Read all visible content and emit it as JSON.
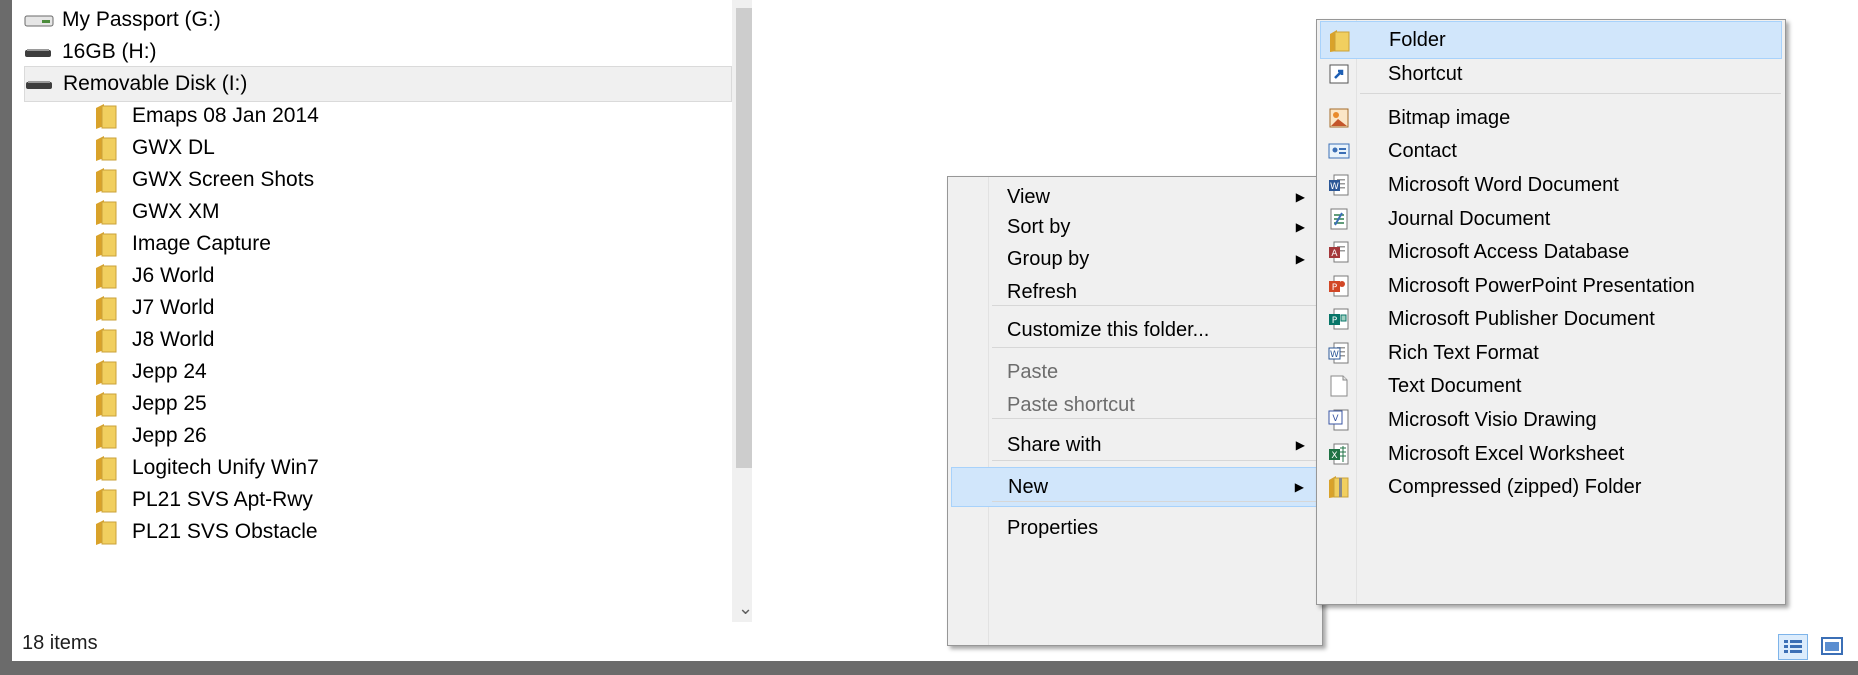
{
  "nav": {
    "drives": [
      {
        "label": "My Passport (G:)",
        "icon": "external-drive-icon"
      },
      {
        "label": "16GB (H:)",
        "icon": "usb-drive-icon"
      },
      {
        "label": "Removable Disk (I:)",
        "icon": "usb-drive-icon"
      }
    ],
    "folders": [
      "Emaps 08 Jan 2014",
      "GWX DL",
      "GWX Screen Shots",
      "GWX XM",
      "Image Capture",
      "J6 World",
      "J7 World",
      "J8 World",
      "Jepp 24",
      "Jepp 25",
      "Jepp 26",
      "Logitech Unify Win7",
      "PL21 SVS Apt-Rwy",
      "PL21 SVS Obstacle"
    ]
  },
  "status": {
    "item_count": "18 items"
  },
  "context_menu": {
    "items": [
      {
        "label": "View",
        "submenu": true
      },
      {
        "label": "Sort by",
        "submenu": true
      },
      {
        "label": "Group by",
        "submenu": true
      },
      {
        "label": "Refresh",
        "submenu": false
      },
      {
        "label": "Customize this folder...",
        "submenu": false
      },
      {
        "label": "Paste",
        "submenu": false,
        "disabled": true
      },
      {
        "label": "Paste shortcut",
        "submenu": false,
        "disabled": true
      },
      {
        "label": "Share with",
        "submenu": true
      },
      {
        "label": "New",
        "submenu": true,
        "highlighted": true
      },
      {
        "label": "Properties",
        "submenu": false
      }
    ],
    "arrow_glyph": "▶"
  },
  "new_submenu": {
    "items": [
      {
        "label": "Folder",
        "icon": "folder-icon",
        "highlighted": true
      },
      {
        "label": "Shortcut",
        "icon": "shortcut-icon"
      },
      {
        "label": "Bitmap image",
        "icon": "bitmap-icon"
      },
      {
        "label": "Contact",
        "icon": "contact-icon"
      },
      {
        "label": "Microsoft Word Document",
        "icon": "word-icon"
      },
      {
        "label": "Journal Document",
        "icon": "journal-icon"
      },
      {
        "label": "Microsoft Access Database",
        "icon": "access-icon"
      },
      {
        "label": "Microsoft PowerPoint Presentation",
        "icon": "powerpoint-icon"
      },
      {
        "label": "Microsoft Publisher Document",
        "icon": "publisher-icon"
      },
      {
        "label": "Rich Text Format",
        "icon": "rtf-icon"
      },
      {
        "label": "Text Document",
        "icon": "text-document-icon"
      },
      {
        "label": "Microsoft Visio Drawing",
        "icon": "visio-icon"
      },
      {
        "label": "Microsoft Excel Worksheet",
        "icon": "excel-icon"
      },
      {
        "label": "Compressed (zipped) Folder",
        "icon": "zip-folder-icon"
      }
    ]
  },
  "colors": {
    "highlight_bg": "#d1e6fb",
    "highlight_border": "#a8d2fb",
    "menu_bg": "#f0f0f0",
    "folder_yellow": "#e8c04a"
  }
}
